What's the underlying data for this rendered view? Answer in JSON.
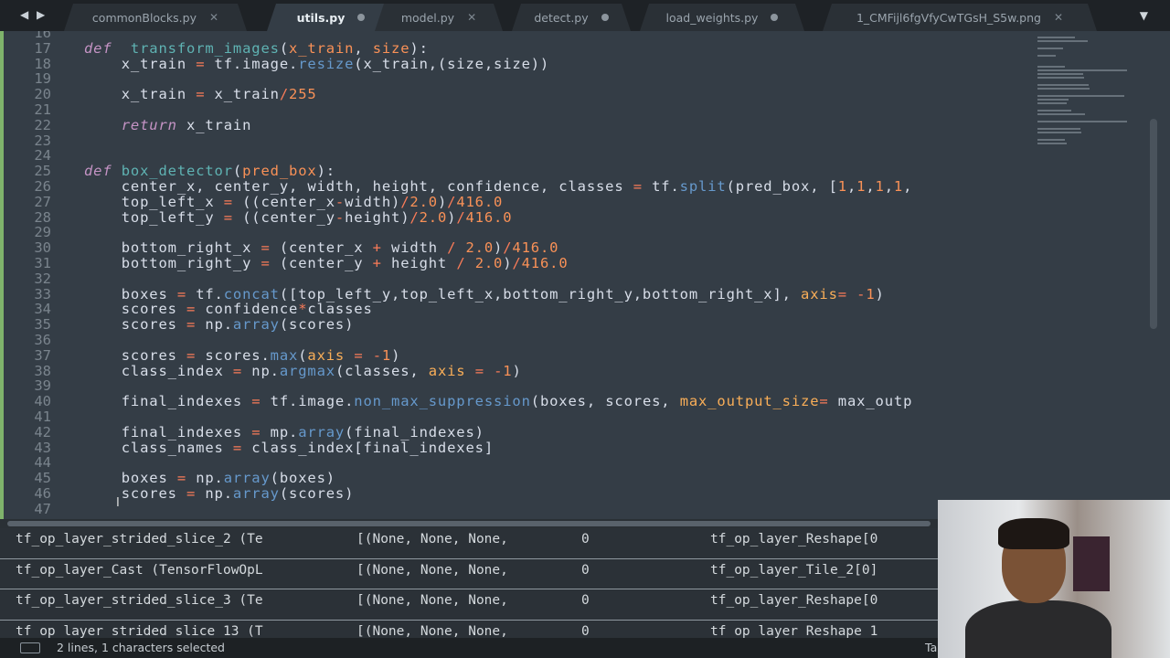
{
  "tabs": [
    {
      "label": "commonBlocks.py",
      "state": "close"
    },
    {
      "label": "utils.py",
      "state": "dirty",
      "active": true
    },
    {
      "label": "model.py",
      "state": "close"
    },
    {
      "label": "detect.py",
      "state": "dirty"
    },
    {
      "label": "load_weights.py",
      "state": "dirty"
    },
    {
      "label": "1_CMFijl6fgVfyCwTGsH_S5w.png",
      "state": "close"
    }
  ],
  "icons": {
    "nav_left": "◀",
    "nav_right": "▶",
    "close": "✕",
    "dropdown": "▼",
    "text_cursor": "I"
  },
  "code": [
    {
      "n": "16",
      "t": []
    },
    {
      "n": "17",
      "t": [
        [
          "k",
          "def"
        ],
        [
          "",
          "  "
        ],
        [
          "f",
          "transform_images"
        ],
        [
          "",
          "("
        ],
        [
          "p",
          "x_train"
        ],
        [
          "",
          ", "
        ],
        [
          "p",
          "size"
        ],
        [
          "",
          "):"
        ]
      ]
    },
    {
      "n": "18",
      "t": [
        [
          "",
          "    x_train "
        ],
        [
          "o",
          "="
        ],
        [
          "",
          " tf.image."
        ],
        [
          "m",
          "resize"
        ],
        [
          "",
          "(x_train,(size,size))"
        ]
      ]
    },
    {
      "n": "19",
      "t": []
    },
    {
      "n": "20",
      "t": [
        [
          "",
          "    x_train "
        ],
        [
          "o",
          "="
        ],
        [
          "",
          " x_train"
        ],
        [
          "o",
          "/"
        ],
        [
          "n",
          "255"
        ]
      ]
    },
    {
      "n": "21",
      "t": []
    },
    {
      "n": "22",
      "t": [
        [
          "",
          "    "
        ],
        [
          "k",
          "return"
        ],
        [
          "",
          " x_train"
        ]
      ]
    },
    {
      "n": "23",
      "t": []
    },
    {
      "n": "24",
      "t": []
    },
    {
      "n": "25",
      "t": [
        [
          "k",
          "def"
        ],
        [
          "",
          " "
        ],
        [
          "f",
          "box_detector"
        ],
        [
          "",
          "("
        ],
        [
          "p",
          "pred_box"
        ],
        [
          "",
          "):"
        ]
      ]
    },
    {
      "n": "26",
      "t": [
        [
          "",
          "    center_x, center_y, width, height, confidence, classes "
        ],
        [
          "o",
          "="
        ],
        [
          "",
          " tf."
        ],
        [
          "m",
          "split"
        ],
        [
          "",
          "(pred_box, ["
        ],
        [
          "n",
          "1"
        ],
        [
          "",
          ","
        ],
        [
          "n",
          "1"
        ],
        [
          "",
          ","
        ],
        [
          "n",
          "1"
        ],
        [
          "",
          ","
        ],
        [
          "n",
          "1"
        ],
        [
          "",
          ","
        ]
      ]
    },
    {
      "n": "27",
      "t": [
        [
          "",
          "    top_left_x "
        ],
        [
          "o",
          "="
        ],
        [
          "",
          " ((center_x"
        ],
        [
          "o",
          "-"
        ],
        [
          "",
          "width)"
        ],
        [
          "o",
          "/"
        ],
        [
          "n",
          "2.0"
        ],
        [
          "",
          ")"
        ],
        [
          "o",
          "/"
        ],
        [
          "n",
          "416.0"
        ]
      ]
    },
    {
      "n": "28",
      "t": [
        [
          "",
          "    top_left_y "
        ],
        [
          "o",
          "="
        ],
        [
          "",
          " ((center_y"
        ],
        [
          "o",
          "-"
        ],
        [
          "",
          "height)"
        ],
        [
          "o",
          "/"
        ],
        [
          "n",
          "2.0"
        ],
        [
          "",
          ")"
        ],
        [
          "o",
          "/"
        ],
        [
          "n",
          "416.0"
        ]
      ]
    },
    {
      "n": "29",
      "t": []
    },
    {
      "n": "30",
      "t": [
        [
          "",
          "    bottom_right_x "
        ],
        [
          "o",
          "="
        ],
        [
          "",
          " (center_x "
        ],
        [
          "o",
          "+"
        ],
        [
          "",
          " width "
        ],
        [
          "o",
          "/"
        ],
        [
          "",
          " "
        ],
        [
          "n",
          "2.0"
        ],
        [
          "",
          ")"
        ],
        [
          "o",
          "/"
        ],
        [
          "n",
          "416.0"
        ]
      ]
    },
    {
      "n": "31",
      "t": [
        [
          "",
          "    bottom_right_y "
        ],
        [
          "o",
          "="
        ],
        [
          "",
          " (center_y "
        ],
        [
          "o",
          "+"
        ],
        [
          "",
          " height "
        ],
        [
          "o",
          "/"
        ],
        [
          "",
          " "
        ],
        [
          "n",
          "2.0"
        ],
        [
          "",
          ")"
        ],
        [
          "o",
          "/"
        ],
        [
          "n",
          "416.0"
        ]
      ]
    },
    {
      "n": "32",
      "t": []
    },
    {
      "n": "33",
      "t": [
        [
          "",
          "    boxes "
        ],
        [
          "o",
          "="
        ],
        [
          "",
          " tf."
        ],
        [
          "m",
          "concat"
        ],
        [
          "",
          "([top_left_y,top_left_x,bottom_right_y,bottom_right_x], "
        ],
        [
          "a",
          "axis"
        ],
        [
          "o",
          "="
        ],
        [
          "",
          " "
        ],
        [
          "o",
          "-"
        ],
        [
          "n",
          "1"
        ],
        [
          "",
          ")"
        ]
      ]
    },
    {
      "n": "34",
      "t": [
        [
          "",
          "    scores "
        ],
        [
          "o",
          "="
        ],
        [
          "",
          " confidence"
        ],
        [
          "o",
          "*"
        ],
        [
          "",
          "classes"
        ]
      ]
    },
    {
      "n": "35",
      "t": [
        [
          "",
          "    scores "
        ],
        [
          "o",
          "="
        ],
        [
          "",
          " np."
        ],
        [
          "m",
          "array"
        ],
        [
          "",
          "(scores)"
        ]
      ]
    },
    {
      "n": "36",
      "t": []
    },
    {
      "n": "37",
      "t": [
        [
          "",
          "    scores "
        ],
        [
          "o",
          "="
        ],
        [
          "",
          " scores."
        ],
        [
          "m",
          "max"
        ],
        [
          "",
          "("
        ],
        [
          "a",
          "axis"
        ],
        [
          "",
          " "
        ],
        [
          "o",
          "="
        ],
        [
          "",
          " "
        ],
        [
          "o",
          "-"
        ],
        [
          "n",
          "1"
        ],
        [
          "",
          ")"
        ]
      ]
    },
    {
      "n": "38",
      "t": [
        [
          "",
          "    class_index "
        ],
        [
          "o",
          "="
        ],
        [
          "",
          " np."
        ],
        [
          "m",
          "argmax"
        ],
        [
          "",
          "(classes, "
        ],
        [
          "a",
          "axis"
        ],
        [
          "",
          " "
        ],
        [
          "o",
          "="
        ],
        [
          "",
          " "
        ],
        [
          "o",
          "-"
        ],
        [
          "n",
          "1"
        ],
        [
          "",
          ")"
        ]
      ]
    },
    {
      "n": "39",
      "t": []
    },
    {
      "n": "40",
      "t": [
        [
          "",
          "    final_indexes "
        ],
        [
          "o",
          "="
        ],
        [
          "",
          " tf.image."
        ],
        [
          "m",
          "non_max_suppression"
        ],
        [
          "",
          "(boxes, scores, "
        ],
        [
          "a",
          "max_output_size"
        ],
        [
          "o",
          "="
        ],
        [
          "",
          " max_outp"
        ]
      ]
    },
    {
      "n": "41",
      "t": []
    },
    {
      "n": "42",
      "t": [
        [
          "",
          "    final_indexes "
        ],
        [
          "o",
          "="
        ],
        [
          "",
          " mp."
        ],
        [
          "m",
          "array"
        ],
        [
          "",
          "(final_indexes)"
        ]
      ]
    },
    {
      "n": "43",
      "t": [
        [
          "",
          "    class_names "
        ],
        [
          "o",
          "="
        ],
        [
          "",
          " class_index[final_indexes]"
        ]
      ]
    },
    {
      "n": "44",
      "t": []
    },
    {
      "n": "45",
      "t": [
        [
          "",
          "    boxes "
        ],
        [
          "o",
          "="
        ],
        [
          "",
          " np."
        ],
        [
          "m",
          "array"
        ],
        [
          "",
          "(boxes)"
        ]
      ]
    },
    {
      "n": "46",
      "t": [
        [
          "",
          "    scores "
        ],
        [
          "o",
          "="
        ],
        [
          "",
          " np."
        ],
        [
          "m",
          "array"
        ],
        [
          "",
          "(scores)"
        ]
      ]
    },
    {
      "n": "47",
      "t": []
    }
  ],
  "panel_rows": [
    {
      "layer": "tf_op_layer_strided_slice_2 (Te",
      "shape": "[(None, None, None,",
      "params": "0",
      "connected": "tf_op_layer_Reshape[0"
    },
    {
      "layer": "tf_op_layer_Cast (TensorFlowOpL",
      "shape": "[(None, None, None,",
      "params": "0",
      "connected": "tf_op_layer_Tile_2[0]"
    },
    {
      "layer": "tf_op_layer_strided_slice_3 (Te",
      "shape": "[(None, None, None,",
      "params": "0",
      "connected": "tf_op_layer_Reshape[0"
    },
    {
      "layer": "tf_op_layer_strided_slice_13 (T",
      "shape": "[(None, None, None,",
      "params": "0",
      "connected": "tf_op_layer_Reshape_1"
    }
  ],
  "status": {
    "selection": "2 lines, 1 characters selected",
    "tab_size": "Ta"
  }
}
